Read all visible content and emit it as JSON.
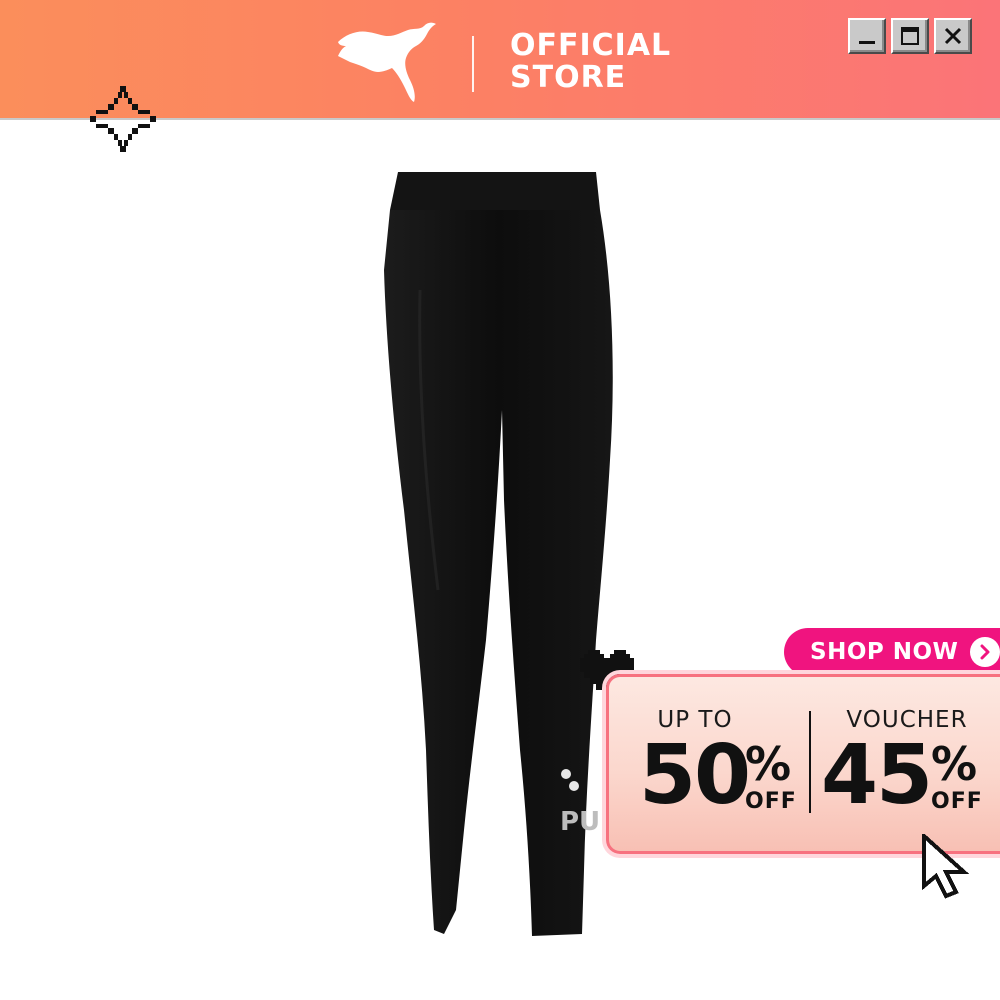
{
  "header": {
    "brand_line1": "OFFICIAL",
    "brand_line2": "STORE",
    "logo_icon": "puma-cat-logo",
    "background_colors": [
      "#fb8e5b",
      "#fb7478"
    ]
  },
  "window_controls": {
    "minimize_icon": "minimize-icon",
    "maximize_icon": "maximize-icon",
    "close_icon": "close-icon"
  },
  "product": {
    "image": "black-leggings",
    "logo_text": "PU"
  },
  "promo": {
    "shop_now_label": "SHOP NOW",
    "accent_color": "#f0147f",
    "left": {
      "label": "UP TO",
      "value": "50",
      "percent": "%",
      "suffix": "OFF"
    },
    "right": {
      "label": "VOUCHER",
      "value": "45",
      "percent": "%",
      "suffix": "OFF"
    }
  },
  "decorations": {
    "sparkle_icon": "sparkle-icon",
    "heart_icon": "pixel-heart-icon",
    "cursor_icon": "pointer-cursor-icon"
  }
}
